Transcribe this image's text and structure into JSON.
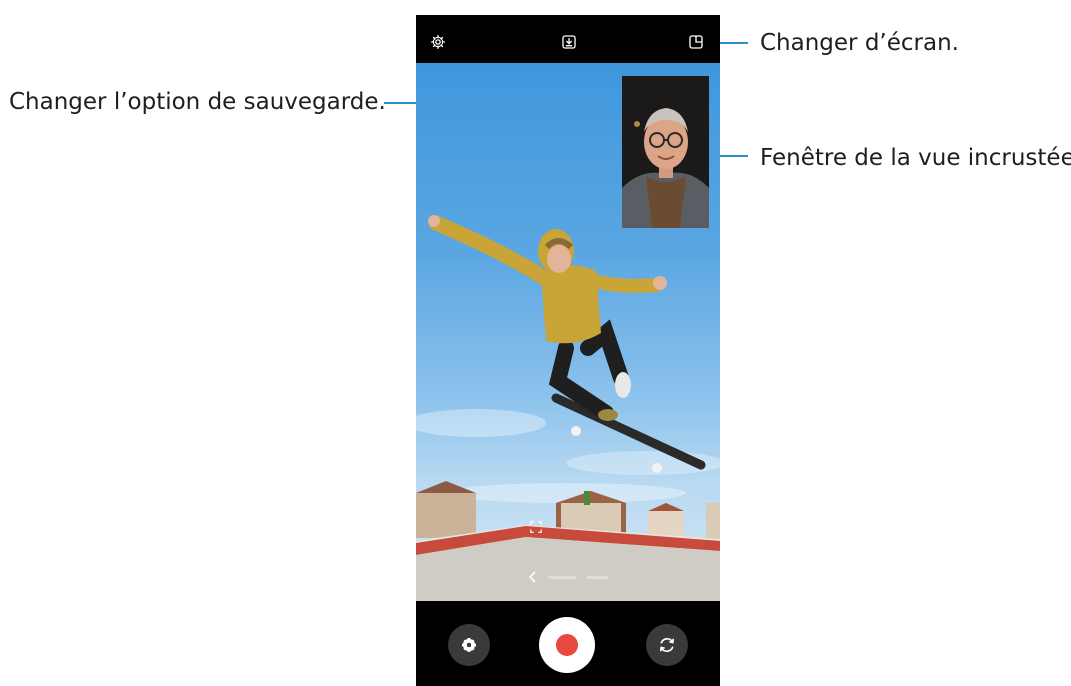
{
  "callouts": {
    "save_option": "Changer l’option de sauvegarde.",
    "switch_screen": "Changer d’écran.",
    "pip_window": "Fenêtre de la vue incrustée"
  },
  "camera": {
    "icons": {
      "settings": "gear-icon",
      "save_option": "download-box-icon",
      "switch_screen": "split-screen-icon",
      "focus": "focus-frame-icon",
      "back": "chevron-left-icon",
      "effects": "flower-icon",
      "record": "record-icon",
      "flip": "flip-camera-icon"
    },
    "colors": {
      "record_dot": "#e8483f",
      "callout_line": "#2a8fc7",
      "bar": "#000000"
    }
  }
}
